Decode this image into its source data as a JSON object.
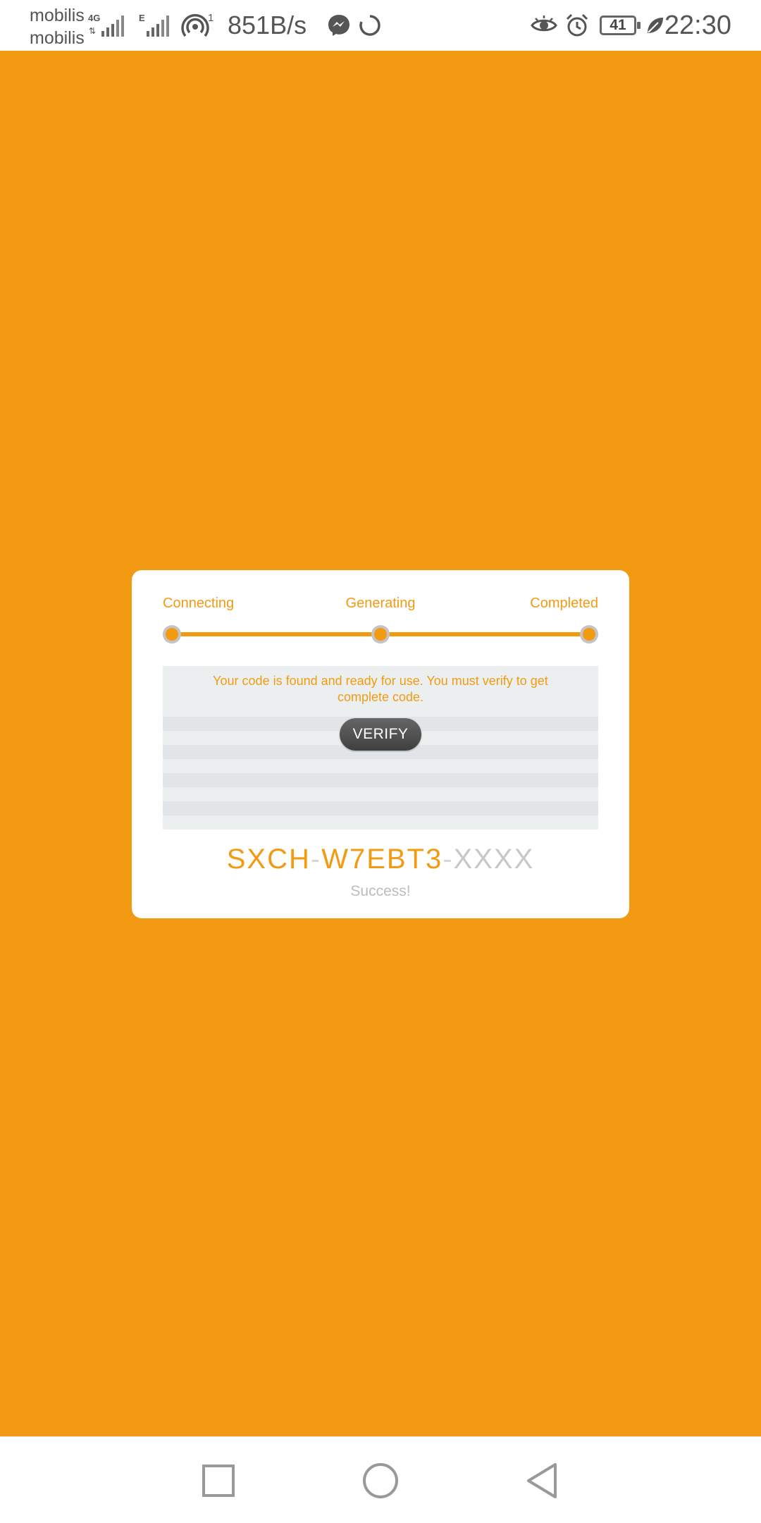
{
  "status_bar": {
    "carrier1": "mobilis",
    "carrier2": "mobilis",
    "net_badge": "4G",
    "net_badge2": "E",
    "hotspot_count": "1",
    "speed": "851B/s",
    "battery": "41",
    "time": "22:30",
    "icons": [
      "signal-icon",
      "hotspot-icon",
      "messenger-icon",
      "sync-icon",
      "eye-icon",
      "alarm-icon",
      "battery-icon",
      "leaf-icon"
    ]
  },
  "progress": {
    "steps": [
      "Connecting",
      "Generating",
      "Completed"
    ],
    "completed_fraction": 1.0
  },
  "card": {
    "message": "Your code is found and ready for use. You must verify to get complete code.",
    "verify_label": "VERIFY",
    "code_prefix": "SXCH",
    "code_middle": "W7EBT3",
    "code_mask": "XXXX",
    "code_separator": "-",
    "status": "Success!"
  },
  "nav": {
    "buttons": [
      "recents-button",
      "home-button",
      "back-button"
    ]
  },
  "colors": {
    "accent": "#f29b12",
    "button": "#4a4a4a",
    "panel": "#eceff0"
  }
}
